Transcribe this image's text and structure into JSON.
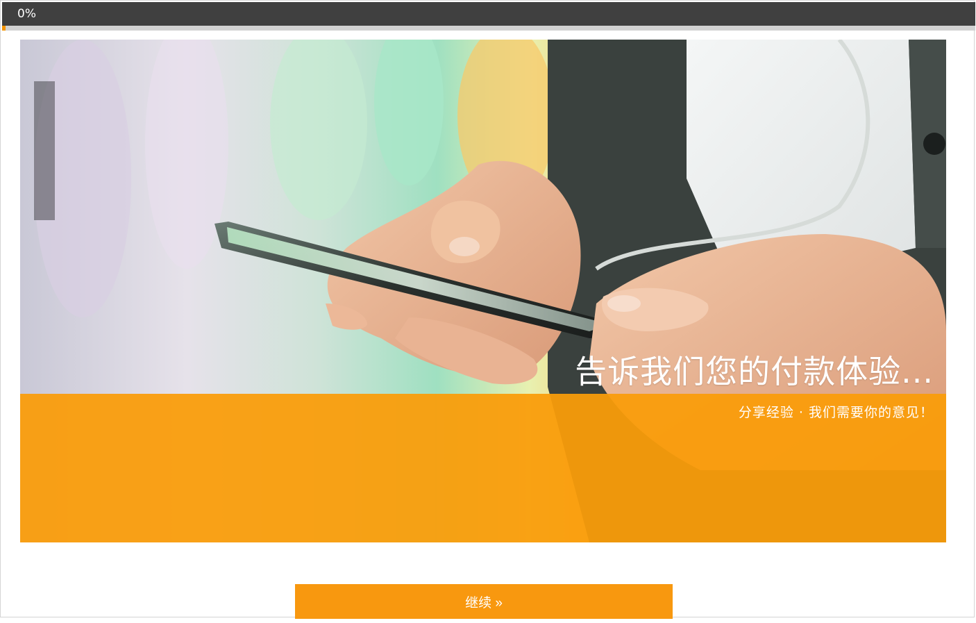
{
  "progress": {
    "label": "0%",
    "value": 0
  },
  "hero": {
    "title": "告诉我们您的付款体验...",
    "subtitle": "分享经验 · 我们需要你的意见！",
    "image_description_icon": "photo-hands-holding-smartphone"
  },
  "actions": {
    "continue_label": "继续 »"
  },
  "colors": {
    "accent": "#f39400",
    "header_bg": "#404040",
    "band": "#fa9c0a"
  }
}
